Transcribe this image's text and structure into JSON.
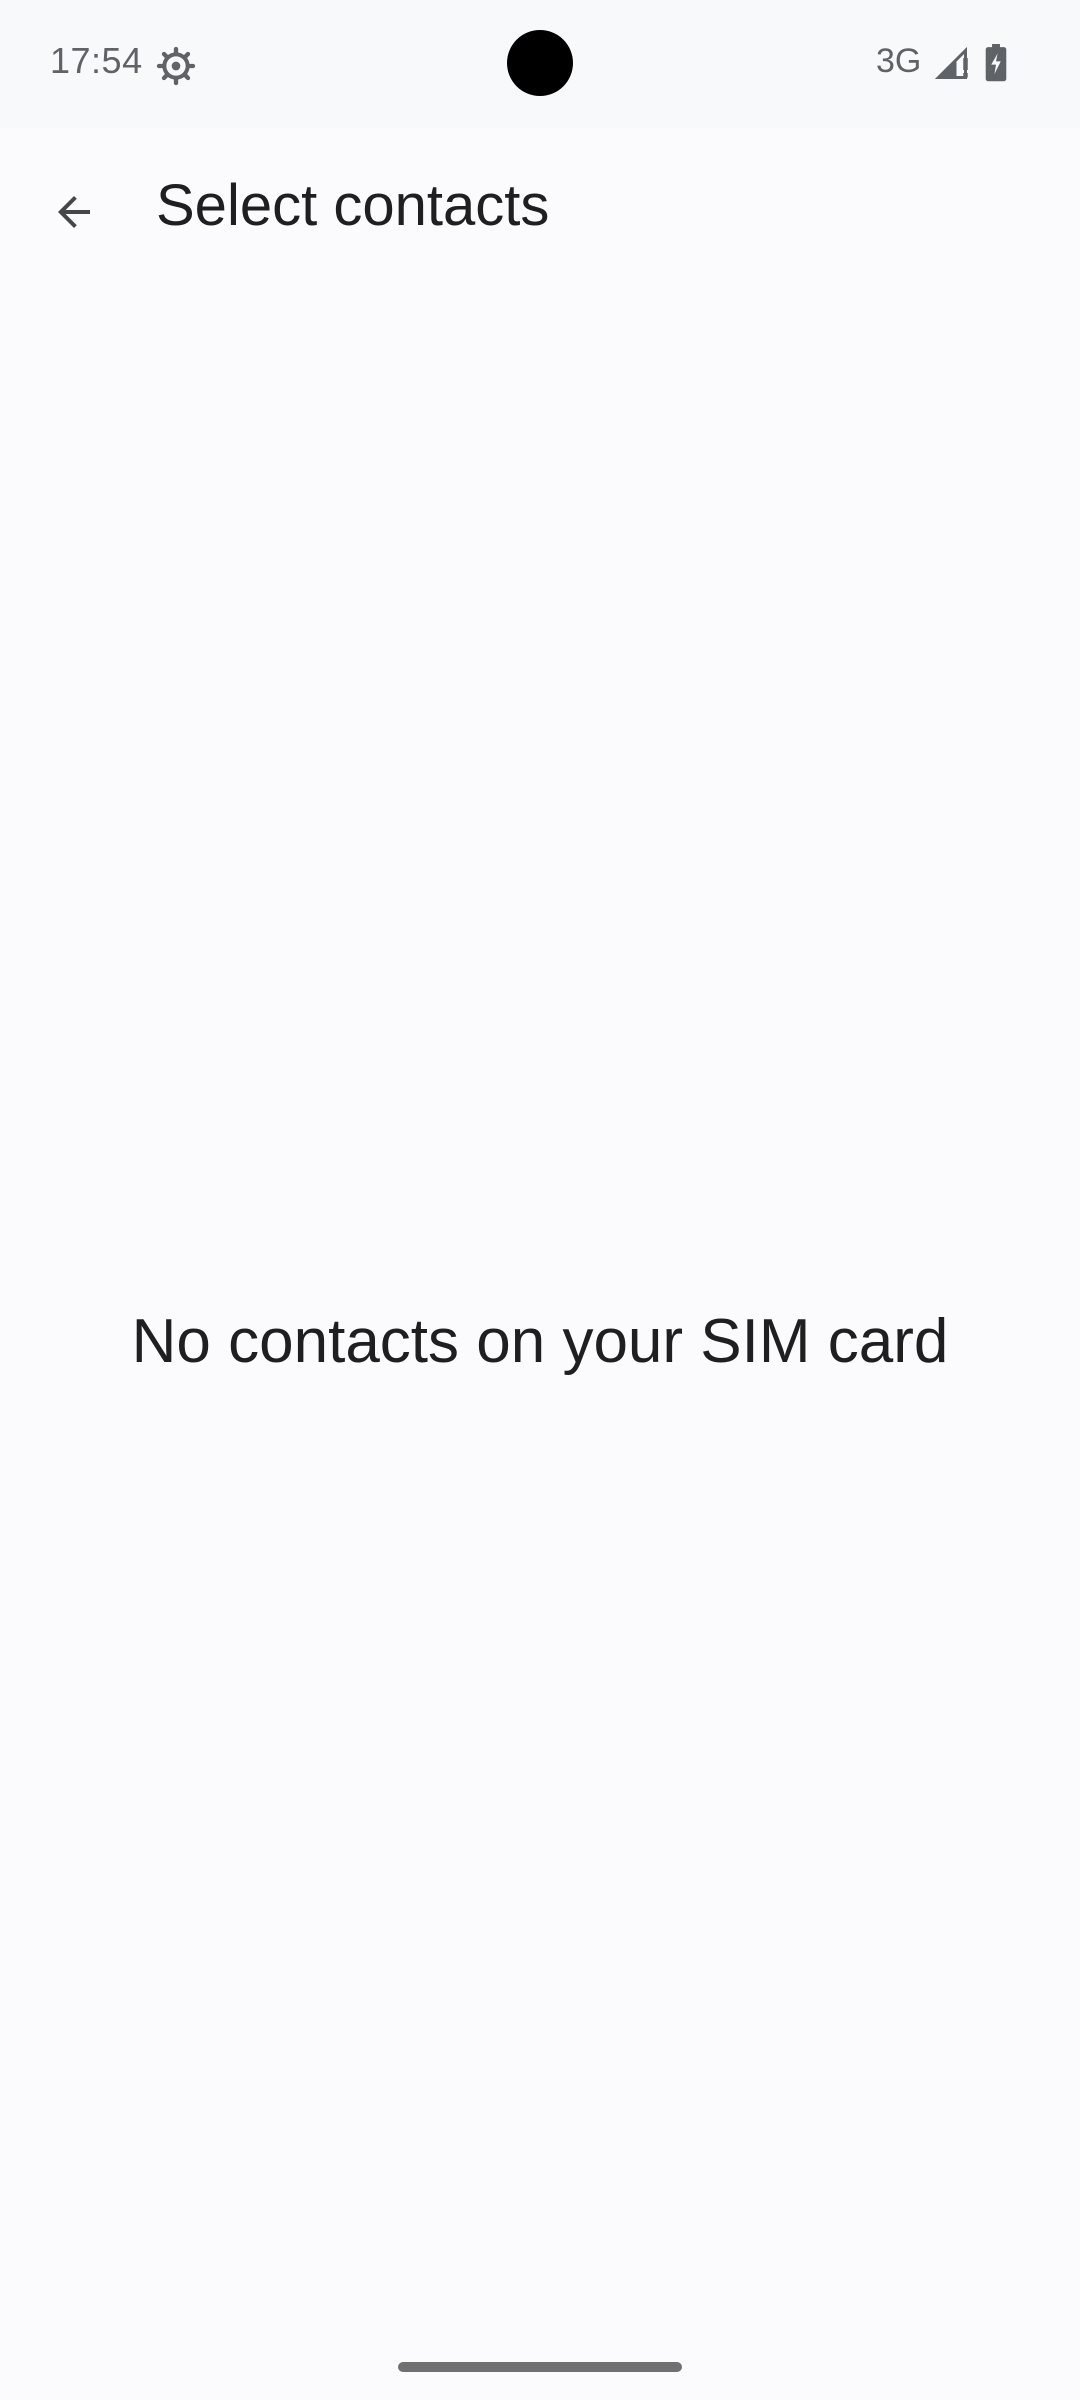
{
  "status_bar": {
    "time": "17:54",
    "network_type": "3G",
    "icons": [
      "settings-gear-icon",
      "signal-icon",
      "battery-charging-icon"
    ]
  },
  "toolbar": {
    "back_icon": "arrow-back-icon",
    "title": "Select contacts"
  },
  "content": {
    "empty_message": "No contacts on your SIM card"
  },
  "colors": {
    "background": "#fbfbfd",
    "text": "#1f1f1f",
    "icon": "#5f6368"
  }
}
